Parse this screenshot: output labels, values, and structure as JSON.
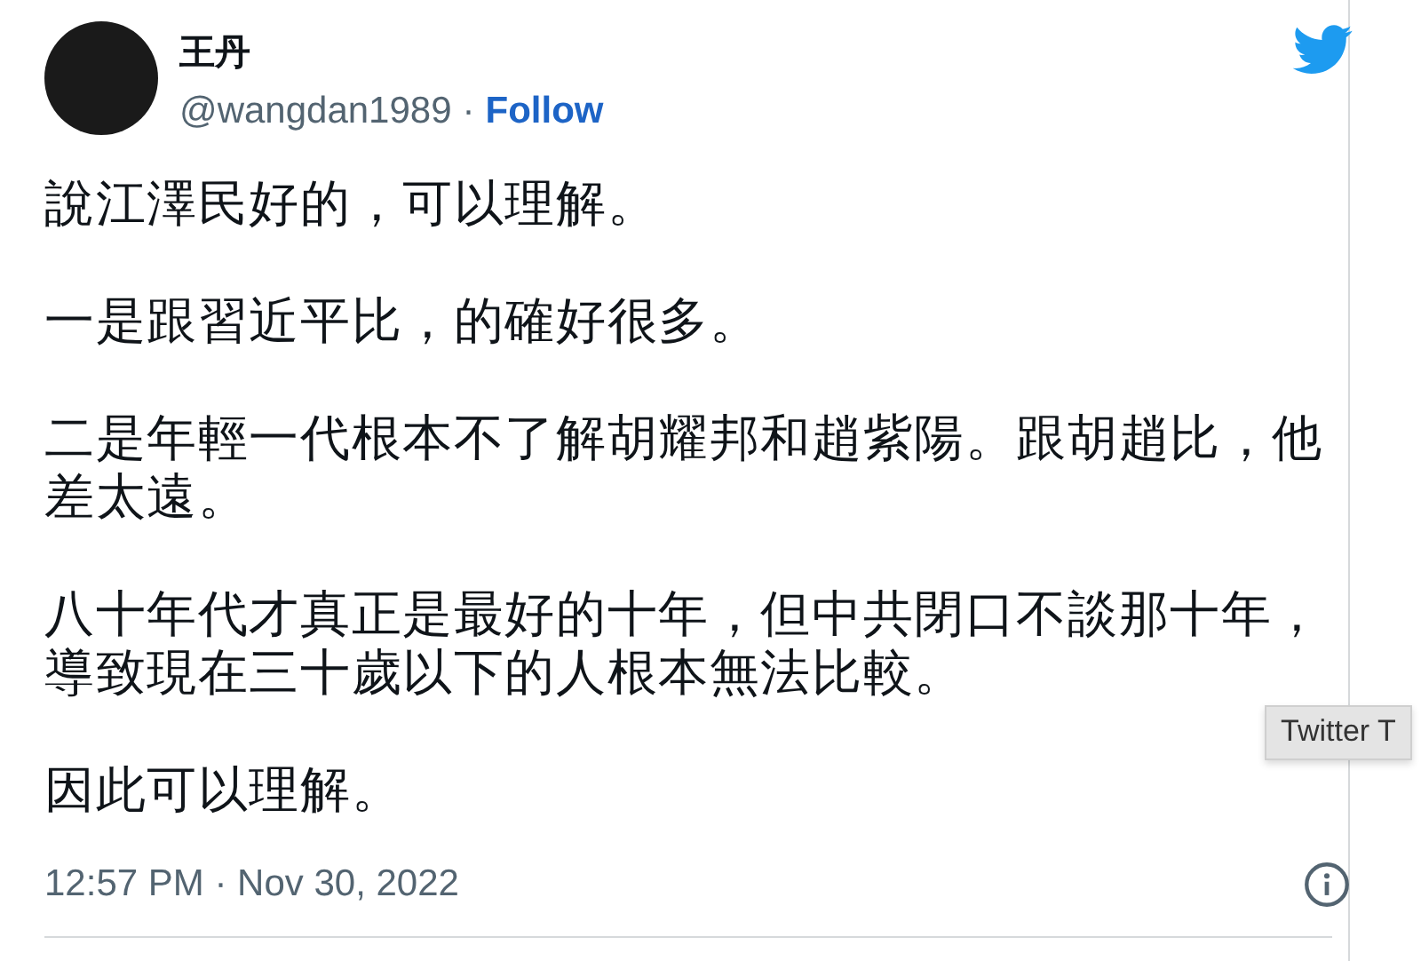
{
  "author": {
    "name": "王丹",
    "handle": "@wangdan1989",
    "separator": "·",
    "follow": "Follow"
  },
  "paragraphs": [
    "說江澤民好的，可以理解。",
    "一是跟習近平比，的確好很多。",
    "二是年輕一代根本不了解胡耀邦和趙紫陽。跟胡趙比，他差太遠。",
    "八十年代才真正是最好的十年，但中共閉口不談那十年，導致現在三十歲以下的人根本無法比較。",
    "因此可以理解。"
  ],
  "timestamp": "12:57 PM · Nov 30, 2022",
  "tooltip": "Twitter T"
}
